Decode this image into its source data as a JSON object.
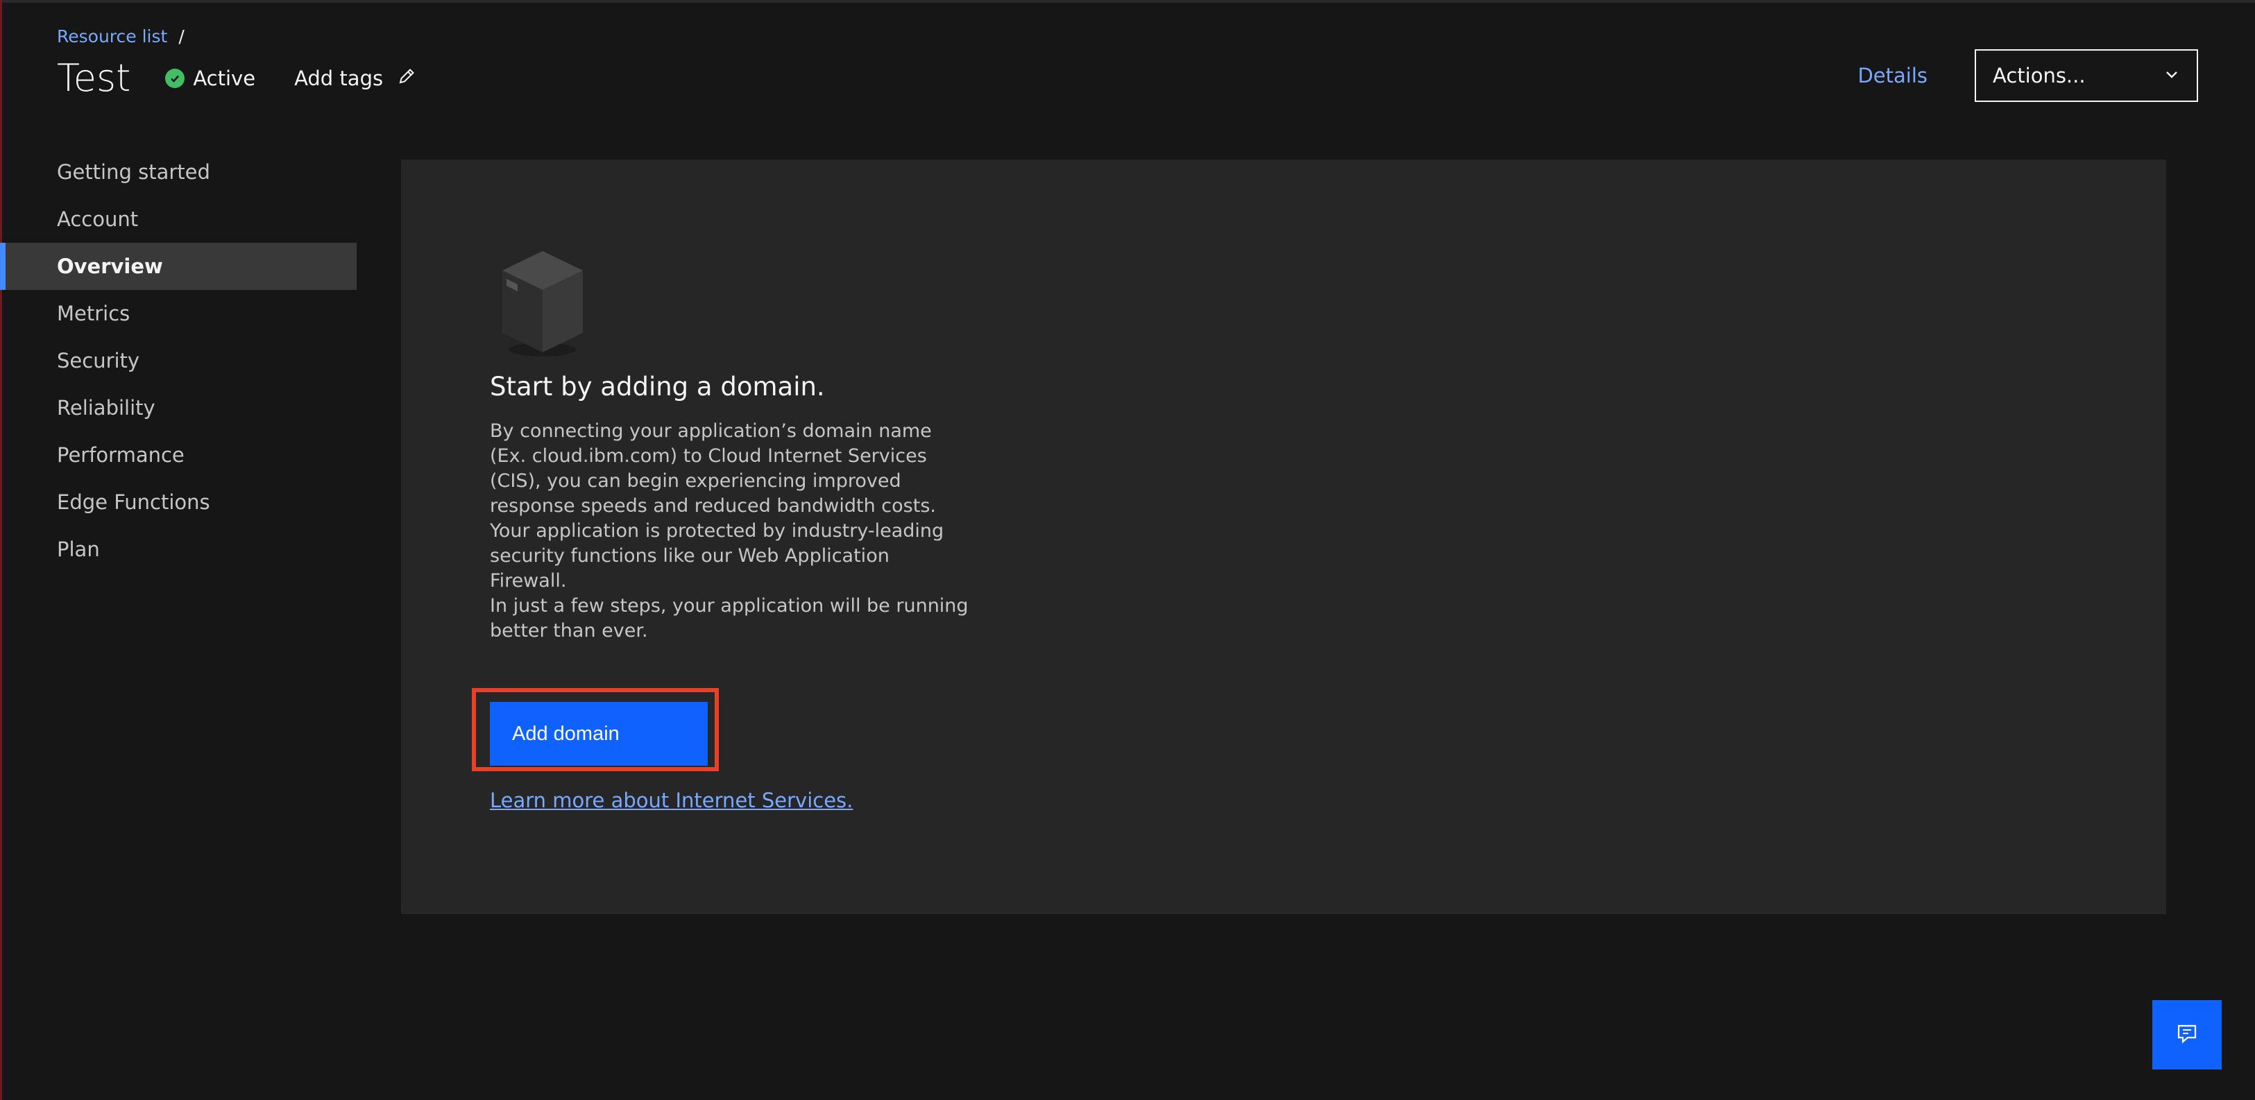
{
  "breadcrumb": {
    "resource_list": "Resource list",
    "separator": "/"
  },
  "header": {
    "title": "Test",
    "status": "Active",
    "add_tags": "Add tags",
    "details": "Details",
    "actions": "Actions..."
  },
  "sidebar": {
    "items": [
      {
        "label": "Getting started",
        "active": false
      },
      {
        "label": "Account",
        "active": false
      },
      {
        "label": "Overview",
        "active": true
      },
      {
        "label": "Metrics",
        "active": false
      },
      {
        "label": "Security",
        "active": false
      },
      {
        "label": "Reliability",
        "active": false
      },
      {
        "label": "Performance",
        "active": false
      },
      {
        "label": "Edge Functions",
        "active": false
      },
      {
        "label": "Plan",
        "active": false
      }
    ]
  },
  "empty_state": {
    "heading": "Start by adding a domain.",
    "body": "By connecting your application’s domain name (Ex. cloud.ibm.com) to Cloud Internet Services (CIS), you can begin experiencing improved response speeds and reduced bandwidth costs. Your application is protected by industry-leading security functions like our Web Application Firewall.",
    "body2": "In just a few steps, your application will be running better than ever.",
    "button": "Add domain",
    "link": "Learn more about Internet Services."
  },
  "colors": {
    "accent": "#0f62fe",
    "link": "#78a9ff",
    "status_green": "#42be65",
    "highlight_border": "#e8402a"
  },
  "icons": {
    "status": "checkmark-filled-icon",
    "edit": "pencil-icon",
    "dropdown": "chevron-down-icon",
    "box": "box-illustration-icon",
    "feedback": "chat-feedback-icon"
  }
}
